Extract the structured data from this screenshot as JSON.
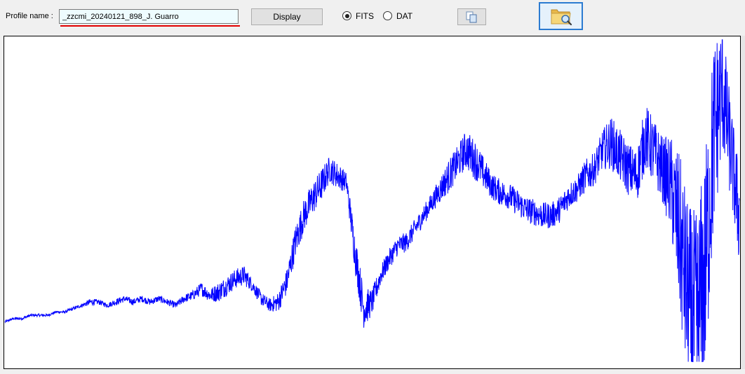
{
  "profile": {
    "label": "Profile name :",
    "value": "_zzcmi_20240121_898_J. Guarro"
  },
  "toolbar": {
    "display_label": "Display"
  },
  "format": {
    "options": [
      "FITS",
      "DAT"
    ],
    "selected": "FITS"
  },
  "icons": {
    "copy": "copy-icon",
    "open": "folder-search-icon"
  },
  "colors": {
    "spectrum_line": "#0000ff",
    "input_background": "#eefcff",
    "spell_underline": "#e00000",
    "selected_button_border": "#2b7bd1"
  },
  "chart_data": {
    "type": "line",
    "title": "",
    "xlabel": "",
    "ylabel": "",
    "axes_visible": false,
    "grid": false,
    "series": [
      {
        "values": [
          0.14,
          0.15,
          0.15,
          0.16,
          0.16,
          0.16,
          0.17,
          0.17,
          0.18,
          0.19,
          0.2,
          0.2,
          0.19,
          0.2,
          0.21,
          0.2,
          0.21,
          0.2,
          0.21,
          0.2,
          0.19,
          0.21,
          0.22,
          0.24,
          0.22,
          0.23,
          0.25,
          0.27,
          0.28,
          0.25,
          0.21,
          0.19,
          0.2,
          0.26,
          0.38,
          0.46,
          0.51,
          0.55,
          0.6,
          0.58,
          0.56,
          0.35,
          0.18,
          0.2,
          0.28,
          0.33,
          0.37,
          0.38,
          0.42,
          0.46,
          0.5,
          0.54,
          0.58,
          0.62,
          0.66,
          0.63,
          0.59,
          0.55,
          0.53,
          0.52,
          0.5,
          0.48,
          0.47,
          0.46,
          0.46,
          0.48,
          0.52,
          0.54,
          0.58,
          0.6,
          0.66,
          0.68,
          0.64,
          0.6,
          0.58,
          0.7,
          0.65,
          0.6,
          0.55,
          0.4,
          0.2,
          0.12,
          0.3,
          0.7,
          0.85,
          0.65,
          0.45
        ],
        "noise": [
          0.004,
          0.004,
          0.004,
          0.004,
          0.004,
          0.004,
          0.004,
          0.004,
          0.005,
          0.006,
          0.01,
          0.008,
          0.007,
          0.01,
          0.01,
          0.01,
          0.01,
          0.01,
          0.01,
          0.01,
          0.01,
          0.012,
          0.015,
          0.02,
          0.02,
          0.03,
          0.03,
          0.03,
          0.03,
          0.02,
          0.02,
          0.02,
          0.03,
          0.04,
          0.05,
          0.05,
          0.05,
          0.05,
          0.04,
          0.04,
          0.03,
          0.06,
          0.06,
          0.04,
          0.03,
          0.03,
          0.03,
          0.03,
          0.03,
          0.03,
          0.03,
          0.04,
          0.05,
          0.05,
          0.06,
          0.06,
          0.05,
          0.04,
          0.04,
          0.04,
          0.04,
          0.04,
          0.04,
          0.04,
          0.04,
          0.04,
          0.04,
          0.04,
          0.05,
          0.05,
          0.06,
          0.08,
          0.08,
          0.08,
          0.08,
          0.1,
          0.1,
          0.1,
          0.15,
          0.25,
          0.3,
          0.35,
          0.35,
          0.3,
          0.2,
          0.15,
          0.15
        ],
        "ylim": [
          0,
          1
        ]
      }
    ]
  }
}
